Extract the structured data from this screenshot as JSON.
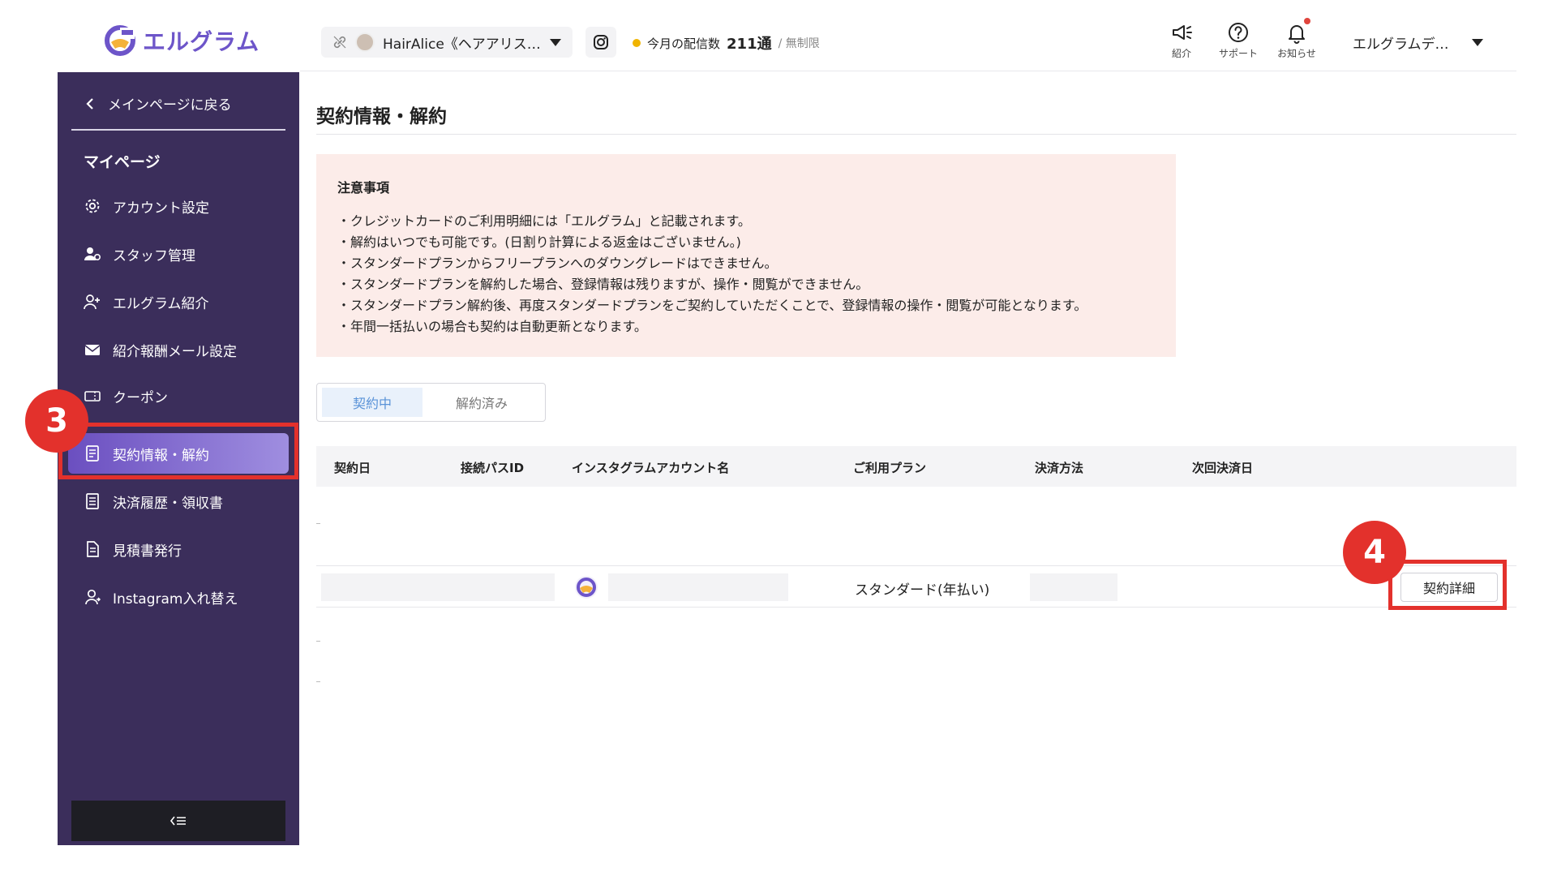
{
  "header": {
    "brand": "エルグラム",
    "account_name": "HairAlice《ヘアアリス…",
    "delivery_label": "今月の配信数",
    "delivery_count": "211通",
    "delivery_limit": "/ 無制限",
    "icons": [
      {
        "name": "megaphone-icon",
        "label": "紹介"
      },
      {
        "name": "help-icon",
        "label": "サポート"
      },
      {
        "name": "bell-icon",
        "label": "お知らせ"
      }
    ],
    "user_name": "エルグラムデ…"
  },
  "sidebar": {
    "back_label": "メインページに戻る",
    "heading": "マイページ",
    "items": [
      {
        "label": "アカウント設定",
        "icon": "gear-icon"
      },
      {
        "label": "スタッフ管理",
        "icon": "staff-icon"
      },
      {
        "label": "エルグラム紹介",
        "icon": "user-plus-icon"
      },
      {
        "label": "紹介報酬メール設定",
        "icon": "mail-icon"
      },
      {
        "label": "クーポン",
        "icon": "coupon-icon"
      },
      {
        "label": "契約情報・解約",
        "icon": "contract-icon",
        "active": true
      },
      {
        "label": "決済履歴・領収書",
        "icon": "receipt-icon"
      },
      {
        "label": "見積書発行",
        "icon": "document-icon"
      },
      {
        "label": "Instagram入れ替え",
        "icon": "user-swap-icon"
      }
    ],
    "collapse_glyph": "<☰"
  },
  "annotations": {
    "step3": "3",
    "step4": "4"
  },
  "main": {
    "title": "契約情報・解約",
    "notice": {
      "heading": "注意事項",
      "lines": [
        "・クレジットカードのご利用明細には「エルグラム」と記載されます。",
        "・解約はいつでも可能です。(日割り計算による返金はございません。)",
        "・スタンダードプランからフリープランへのダウングレードはできません。",
        "・スタンダードプランを解約した場合、登録情報は残りますが、操作・閲覧ができません。",
        "・スタンダードプラン解約後、再度スタンダードプランをご契約していただくことで、登録情報の操作・閲覧が可能となります。",
        "・年間一括払いの場合も契約は自動更新となります。"
      ]
    },
    "tabs": [
      {
        "label": "契約中",
        "active": true
      },
      {
        "label": "解約済み",
        "active": false
      }
    ],
    "table": {
      "columns": [
        "契約日",
        "接続パスID",
        "インスタグラムアカウント名",
        "ご利用プラン",
        "決済方法",
        "次回決済日"
      ],
      "rows": [
        {
          "plan": "スタンダード(年払い)",
          "action": "契約詳細"
        }
      ]
    }
  },
  "colors": {
    "sidebar_bg": "#3b2e5b",
    "accent": "#6d55c9",
    "annotation_red": "#e3312c",
    "notice_bg": "#fcece9"
  }
}
